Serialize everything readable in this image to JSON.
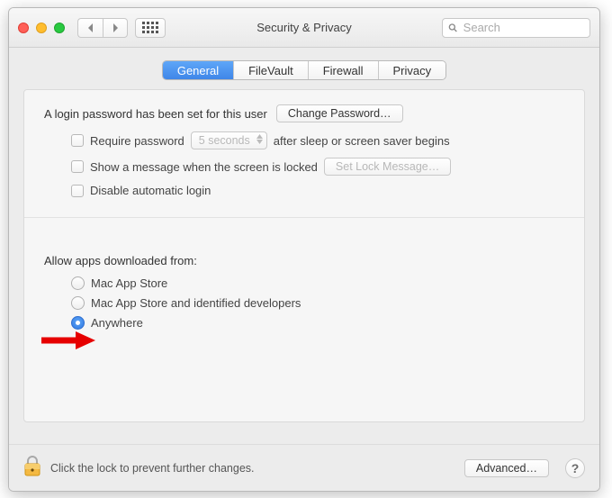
{
  "header": {
    "title": "Security & Privacy",
    "search_placeholder": "Search"
  },
  "tabs": {
    "general": "General",
    "filevault": "FileVault",
    "firewall": "Firewall",
    "privacy": "Privacy"
  },
  "login": {
    "password_set_text": "A login password has been set for this user",
    "change_password_label": "Change Password…",
    "require_password_label": "Require password",
    "require_password_delay": "5 seconds",
    "require_password_suffix": "after sleep or screen saver begins",
    "show_message_label": "Show a message when the screen is locked",
    "set_lock_message_label": "Set Lock Message…",
    "disable_auto_login_label": "Disable automatic login"
  },
  "download_section": {
    "title": "Allow apps downloaded from:",
    "options": {
      "mac_app_store": "Mac App Store",
      "identified": "Mac App Store and identified developers",
      "anywhere": "Anywhere"
    }
  },
  "footer": {
    "lock_text": "Click the lock to prevent further changes.",
    "advanced_label": "Advanced…",
    "help_label": "?"
  }
}
